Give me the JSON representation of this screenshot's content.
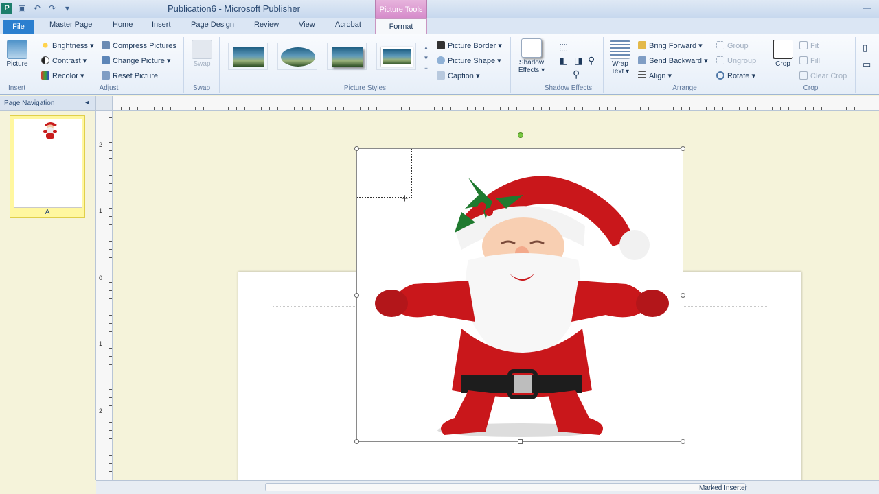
{
  "app": {
    "title": "Publication6 - Microsoft Publisher",
    "icon_label": "P",
    "contextual_tab": "Picture Tools"
  },
  "colors": {
    "file_tab": "#2b7fcf",
    "contextual_tab": "#d68ccb",
    "workspace": "#f5f3da",
    "rotate_handle": "#7ac943"
  },
  "quick_access": [
    {
      "icon": "save-icon",
      "glyph": "▣"
    },
    {
      "icon": "undo-icon",
      "glyph": "↶"
    },
    {
      "icon": "redo-icon",
      "glyph": "↷"
    },
    {
      "icon": "customize-icon",
      "glyph": "▾"
    }
  ],
  "window_controls": [
    {
      "icon": "minimize-icon",
      "glyph": "—"
    }
  ],
  "tabs": [
    "File",
    "Master Page",
    "Home",
    "Insert",
    "Page Design",
    "Review",
    "View",
    "Acrobat",
    "Format"
  ],
  "ribbon": {
    "insert": {
      "picture": "Picture",
      "label": "Insert"
    },
    "adjust": {
      "brightness": "Brightness ▾",
      "contrast": "Contrast ▾",
      "recolor": "Recolor ▾",
      "compress": "Compress Pictures",
      "change": "Change Picture ▾",
      "reset": "Reset Picture",
      "label": "Adjust"
    },
    "swap": {
      "button": "Swap",
      "label": "Swap"
    },
    "picture_styles": {
      "border": "Picture Border ▾",
      "shape": "Picture Shape ▾",
      "caption": "Caption ▾",
      "label": "Picture Styles"
    },
    "shadow": {
      "button": "Shadow Effects ▾",
      "label": "Shadow Effects"
    },
    "arrange": {
      "wrap": "Wrap Text ▾",
      "forward": "Bring Forward ▾",
      "backward": "Send Backward ▾",
      "align": "Align ▾",
      "group": "Group",
      "ungroup": "Ungroup",
      "rotate": "Rotate ▾",
      "label": "Arrange"
    },
    "crop": {
      "crop": "Crop",
      "fit": "Fit",
      "fill": "Fill",
      "clear": "Clear Crop",
      "label": "Crop"
    }
  },
  "nav": {
    "header": "Page Navigation",
    "collapse": "◂",
    "page_number": "A"
  },
  "ruler_left_numbers": [
    "2",
    "1",
    "0",
    "1",
    "2"
  ],
  "status": {
    "text": "Marked Inserter"
  }
}
